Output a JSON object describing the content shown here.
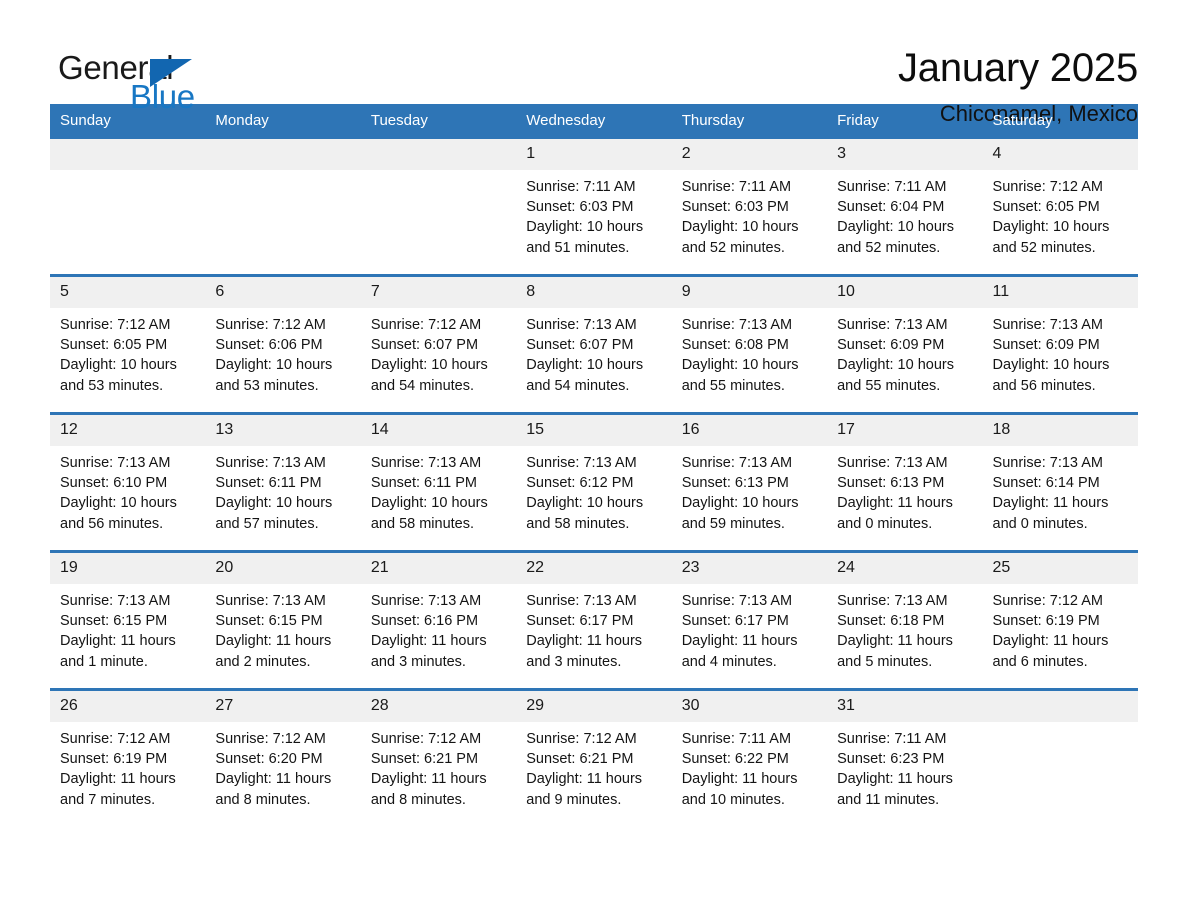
{
  "brand": {
    "name_part1": "General",
    "name_part2": "Blue",
    "triangle_color": "#1266b0",
    "blue_text_color": "#1877c4"
  },
  "header": {
    "title": "January 2025",
    "location": "Chiconamel, Mexico",
    "accent_color": "#2e75b6",
    "daynum_bg": "#f0f0f0"
  },
  "weekdays": [
    "Sunday",
    "Monday",
    "Tuesday",
    "Wednesday",
    "Thursday",
    "Friday",
    "Saturday"
  ],
  "weeks": [
    [
      {
        "day": "",
        "empty": true
      },
      {
        "day": "",
        "empty": true
      },
      {
        "day": "",
        "empty": true
      },
      {
        "day": "1",
        "sunrise": "Sunrise: 7:11 AM",
        "sunset": "Sunset: 6:03 PM",
        "daylight1": "Daylight: 10 hours",
        "daylight2": "and 51 minutes."
      },
      {
        "day": "2",
        "sunrise": "Sunrise: 7:11 AM",
        "sunset": "Sunset: 6:03 PM",
        "daylight1": "Daylight: 10 hours",
        "daylight2": "and 52 minutes."
      },
      {
        "day": "3",
        "sunrise": "Sunrise: 7:11 AM",
        "sunset": "Sunset: 6:04 PM",
        "daylight1": "Daylight: 10 hours",
        "daylight2": "and 52 minutes."
      },
      {
        "day": "4",
        "sunrise": "Sunrise: 7:12 AM",
        "sunset": "Sunset: 6:05 PM",
        "daylight1": "Daylight: 10 hours",
        "daylight2": "and 52 minutes."
      }
    ],
    [
      {
        "day": "5",
        "sunrise": "Sunrise: 7:12 AM",
        "sunset": "Sunset: 6:05 PM",
        "daylight1": "Daylight: 10 hours",
        "daylight2": "and 53 minutes."
      },
      {
        "day": "6",
        "sunrise": "Sunrise: 7:12 AM",
        "sunset": "Sunset: 6:06 PM",
        "daylight1": "Daylight: 10 hours",
        "daylight2": "and 53 minutes."
      },
      {
        "day": "7",
        "sunrise": "Sunrise: 7:12 AM",
        "sunset": "Sunset: 6:07 PM",
        "daylight1": "Daylight: 10 hours",
        "daylight2": "and 54 minutes."
      },
      {
        "day": "8",
        "sunrise": "Sunrise: 7:13 AM",
        "sunset": "Sunset: 6:07 PM",
        "daylight1": "Daylight: 10 hours",
        "daylight2": "and 54 minutes."
      },
      {
        "day": "9",
        "sunrise": "Sunrise: 7:13 AM",
        "sunset": "Sunset: 6:08 PM",
        "daylight1": "Daylight: 10 hours",
        "daylight2": "and 55 minutes."
      },
      {
        "day": "10",
        "sunrise": "Sunrise: 7:13 AM",
        "sunset": "Sunset: 6:09 PM",
        "daylight1": "Daylight: 10 hours",
        "daylight2": "and 55 minutes."
      },
      {
        "day": "11",
        "sunrise": "Sunrise: 7:13 AM",
        "sunset": "Sunset: 6:09 PM",
        "daylight1": "Daylight: 10 hours",
        "daylight2": "and 56 minutes."
      }
    ],
    [
      {
        "day": "12",
        "sunrise": "Sunrise: 7:13 AM",
        "sunset": "Sunset: 6:10 PM",
        "daylight1": "Daylight: 10 hours",
        "daylight2": "and 56 minutes."
      },
      {
        "day": "13",
        "sunrise": "Sunrise: 7:13 AM",
        "sunset": "Sunset: 6:11 PM",
        "daylight1": "Daylight: 10 hours",
        "daylight2": "and 57 minutes."
      },
      {
        "day": "14",
        "sunrise": "Sunrise: 7:13 AM",
        "sunset": "Sunset: 6:11 PM",
        "daylight1": "Daylight: 10 hours",
        "daylight2": "and 58 minutes."
      },
      {
        "day": "15",
        "sunrise": "Sunrise: 7:13 AM",
        "sunset": "Sunset: 6:12 PM",
        "daylight1": "Daylight: 10 hours",
        "daylight2": "and 58 minutes."
      },
      {
        "day": "16",
        "sunrise": "Sunrise: 7:13 AM",
        "sunset": "Sunset: 6:13 PM",
        "daylight1": "Daylight: 10 hours",
        "daylight2": "and 59 minutes."
      },
      {
        "day": "17",
        "sunrise": "Sunrise: 7:13 AM",
        "sunset": "Sunset: 6:13 PM",
        "daylight1": "Daylight: 11 hours",
        "daylight2": "and 0 minutes."
      },
      {
        "day": "18",
        "sunrise": "Sunrise: 7:13 AM",
        "sunset": "Sunset: 6:14 PM",
        "daylight1": "Daylight: 11 hours",
        "daylight2": "and 0 minutes."
      }
    ],
    [
      {
        "day": "19",
        "sunrise": "Sunrise: 7:13 AM",
        "sunset": "Sunset: 6:15 PM",
        "daylight1": "Daylight: 11 hours",
        "daylight2": "and 1 minute."
      },
      {
        "day": "20",
        "sunrise": "Sunrise: 7:13 AM",
        "sunset": "Sunset: 6:15 PM",
        "daylight1": "Daylight: 11 hours",
        "daylight2": "and 2 minutes."
      },
      {
        "day": "21",
        "sunrise": "Sunrise: 7:13 AM",
        "sunset": "Sunset: 6:16 PM",
        "daylight1": "Daylight: 11 hours",
        "daylight2": "and 3 minutes."
      },
      {
        "day": "22",
        "sunrise": "Sunrise: 7:13 AM",
        "sunset": "Sunset: 6:17 PM",
        "daylight1": "Daylight: 11 hours",
        "daylight2": "and 3 minutes."
      },
      {
        "day": "23",
        "sunrise": "Sunrise: 7:13 AM",
        "sunset": "Sunset: 6:17 PM",
        "daylight1": "Daylight: 11 hours",
        "daylight2": "and 4 minutes."
      },
      {
        "day": "24",
        "sunrise": "Sunrise: 7:13 AM",
        "sunset": "Sunset: 6:18 PM",
        "daylight1": "Daylight: 11 hours",
        "daylight2": "and 5 minutes."
      },
      {
        "day": "25",
        "sunrise": "Sunrise: 7:12 AM",
        "sunset": "Sunset: 6:19 PM",
        "daylight1": "Daylight: 11 hours",
        "daylight2": "and 6 minutes."
      }
    ],
    [
      {
        "day": "26",
        "sunrise": "Sunrise: 7:12 AM",
        "sunset": "Sunset: 6:19 PM",
        "daylight1": "Daylight: 11 hours",
        "daylight2": "and 7 minutes."
      },
      {
        "day": "27",
        "sunrise": "Sunrise: 7:12 AM",
        "sunset": "Sunset: 6:20 PM",
        "daylight1": "Daylight: 11 hours",
        "daylight2": "and 8 minutes."
      },
      {
        "day": "28",
        "sunrise": "Sunrise: 7:12 AM",
        "sunset": "Sunset: 6:21 PM",
        "daylight1": "Daylight: 11 hours",
        "daylight2": "and 8 minutes."
      },
      {
        "day": "29",
        "sunrise": "Sunrise: 7:12 AM",
        "sunset": "Sunset: 6:21 PM",
        "daylight1": "Daylight: 11 hours",
        "daylight2": "and 9 minutes."
      },
      {
        "day": "30",
        "sunrise": "Sunrise: 7:11 AM",
        "sunset": "Sunset: 6:22 PM",
        "daylight1": "Daylight: 11 hours",
        "daylight2": "and 10 minutes."
      },
      {
        "day": "31",
        "sunrise": "Sunrise: 7:11 AM",
        "sunset": "Sunset: 6:23 PM",
        "daylight1": "Daylight: 11 hours",
        "daylight2": "and 11 minutes."
      },
      {
        "day": "",
        "empty": true
      }
    ]
  ]
}
